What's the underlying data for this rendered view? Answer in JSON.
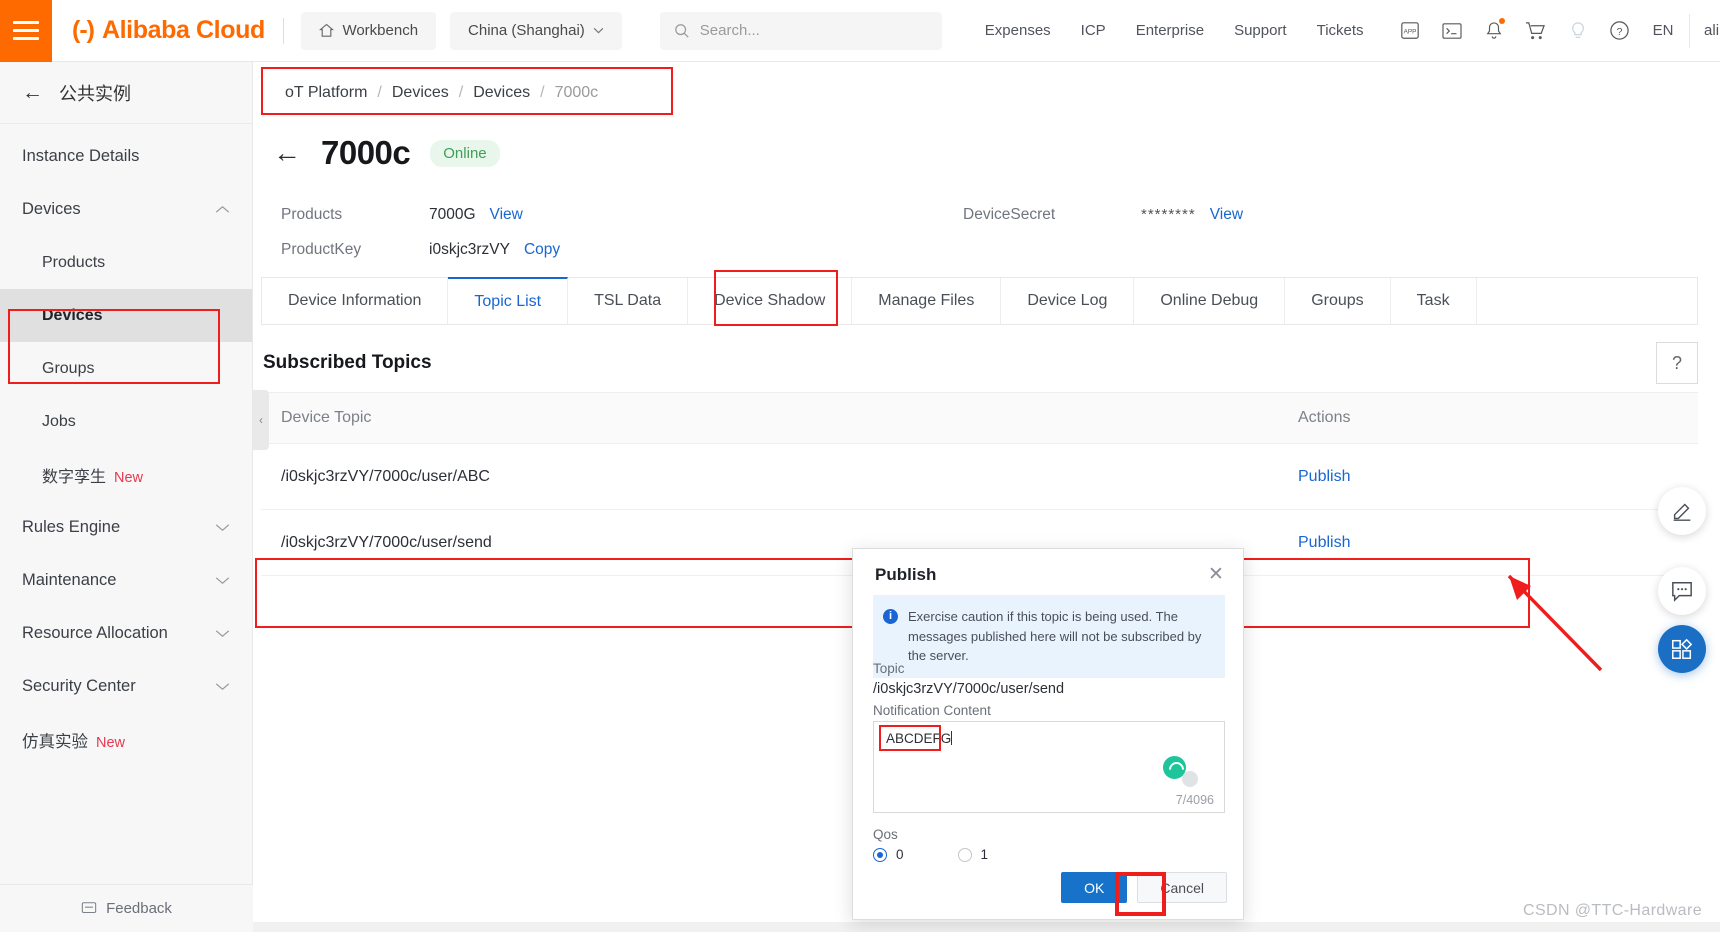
{
  "topbar": {
    "brand_mark": "(-)",
    "brand_name": "Alibaba Cloud",
    "workbench": "Workbench",
    "region": "China (Shanghai)",
    "search_placeholder": "Search...",
    "links": [
      "Expenses",
      "ICP",
      "Enterprise",
      "Support",
      "Tickets"
    ],
    "lang": "EN",
    "account": "ali",
    "icons": [
      "app-icon",
      "terminal-icon",
      "bell-icon",
      "cart-icon",
      "bulb-icon",
      "help-circle-icon"
    ]
  },
  "sidebar": {
    "back_label": "公共实例",
    "items": [
      {
        "label": "Instance Details",
        "level": 0,
        "chevron": "",
        "active": false,
        "badge": ""
      },
      {
        "label": "Devices",
        "level": 0,
        "chevron": "^",
        "active": false,
        "badge": ""
      },
      {
        "label": "Products",
        "level": 1,
        "chevron": "",
        "active": false,
        "badge": ""
      },
      {
        "label": "Devices",
        "level": 1,
        "chevron": "",
        "active": true,
        "badge": ""
      },
      {
        "label": "Groups",
        "level": 1,
        "chevron": "",
        "active": false,
        "badge": ""
      },
      {
        "label": "Jobs",
        "level": 1,
        "chevron": "",
        "active": false,
        "badge": ""
      },
      {
        "label": "数字孪生",
        "level": 1,
        "chevron": "",
        "active": false,
        "badge": "New"
      },
      {
        "label": "Rules Engine",
        "level": 0,
        "chevron": "v",
        "active": false,
        "badge": ""
      },
      {
        "label": "Maintenance",
        "level": 0,
        "chevron": "v",
        "active": false,
        "badge": ""
      },
      {
        "label": "Resource Allocation",
        "level": 0,
        "chevron": "v",
        "active": false,
        "badge": ""
      },
      {
        "label": "Security Center",
        "level": 0,
        "chevron": "v",
        "active": false,
        "badge": ""
      },
      {
        "label": "仿真实验",
        "level": 0,
        "chevron": "",
        "active": false,
        "badge": "New"
      }
    ],
    "feedback": "Feedback"
  },
  "breadcrumb": {
    "items": [
      "oT Platform",
      "Devices",
      "Devices",
      "7000c"
    ],
    "separator": "/"
  },
  "header": {
    "title": "7000c",
    "status": "Online",
    "products_label": "Products",
    "products_value": "7000G",
    "products_view": "View",
    "productkey_label": "ProductKey",
    "productkey_value": "i0skjc3rzVY",
    "productkey_copy": "Copy",
    "secret_label": "DeviceSecret",
    "secret_value": "********",
    "secret_view": "View"
  },
  "tabs": [
    {
      "label": "Device Information",
      "active": false
    },
    {
      "label": "Topic List",
      "active": true
    },
    {
      "label": "TSL Data",
      "active": false
    },
    {
      "label": "Device Shadow",
      "active": false
    },
    {
      "label": "Manage Files",
      "active": false
    },
    {
      "label": "Device Log",
      "active": false
    },
    {
      "label": "Online Debug",
      "active": false
    },
    {
      "label": "Groups",
      "active": false
    },
    {
      "label": "Task",
      "active": false
    }
  ],
  "table": {
    "section_title": "Subscribed Topics",
    "help_icon": "?",
    "columns": [
      "Device Topic",
      "Actions"
    ],
    "rows": [
      {
        "topic": "/i0skjc3rzVY/7000c/user/ABC",
        "action": "Publish"
      },
      {
        "topic": "/i0skjc3rzVY/7000c/user/send",
        "action": "Publish"
      }
    ]
  },
  "dialog": {
    "title": "Publish",
    "close_icon": "✕",
    "alert": "Exercise caution if this topic is being used. The messages published here will not be subscribed by the server.",
    "topic_label": "Topic",
    "topic_value": "/i0skjc3rzVY/7000c/user/send",
    "content_label": "Notification Content",
    "content_value": "ABCDEFG",
    "char_count": "7/4096",
    "qos_label": "Qos",
    "qos_options": [
      "0",
      "1"
    ],
    "qos_selected": "0",
    "ok_label": "OK",
    "cancel_label": "Cancel"
  },
  "fabs": [
    {
      "name": "edit-pencil-icon"
    },
    {
      "name": "feedback-chat-icon"
    },
    {
      "name": "apps-grid-icon"
    }
  ],
  "watermark": "CSDN @TTC-Hardware",
  "colors": {
    "brand_orange": "#ff6a00",
    "link_blue": "#1966d2",
    "primary_button": "#1673c9",
    "annotation_red": "#f01d1d",
    "online_green": "#3f9e56"
  }
}
